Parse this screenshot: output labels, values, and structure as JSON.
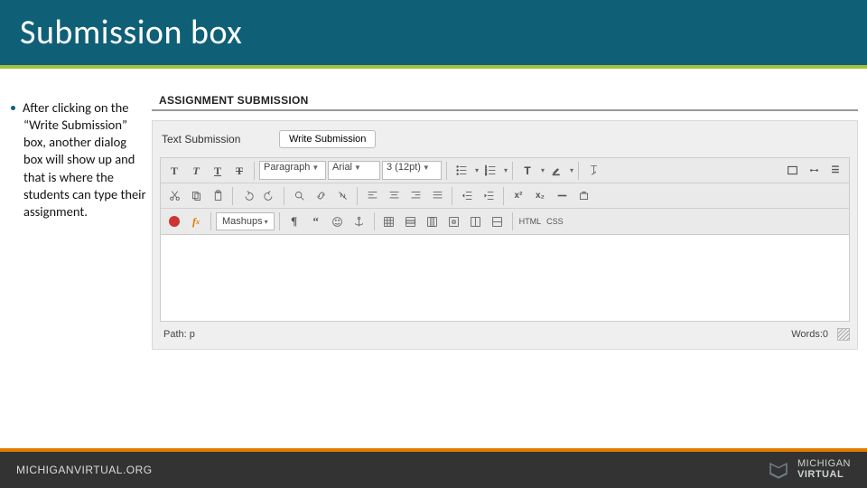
{
  "slide_title": "Submission box",
  "bullet_text": "After clicking on the “Write Submission” box, another dialog box will show up and that is where the students can type their assignment.",
  "screenshot": {
    "section_heading": "ASSIGNMENT SUBMISSION",
    "text_submission_label": "Text Submission",
    "write_submission_button": "Write Submission",
    "toolbar": {
      "row1": {
        "bold": "T",
        "italic": "T",
        "underline": "T",
        "strike": "T",
        "paragraph_select": "Paragraph",
        "font_select": "Arial",
        "size_select": "3 (12pt)",
        "html_label": "HTML",
        "css_label": "CSS"
      },
      "row3": {
        "mashups_label": "Mashups"
      }
    },
    "path_label": "Path: p",
    "words_label": "Words:0"
  },
  "footer": {
    "url": "MICHIGANVIRTUAL.ORG",
    "brand_top": "MICHIGAN",
    "brand_bottom": "VIRTUAL"
  }
}
